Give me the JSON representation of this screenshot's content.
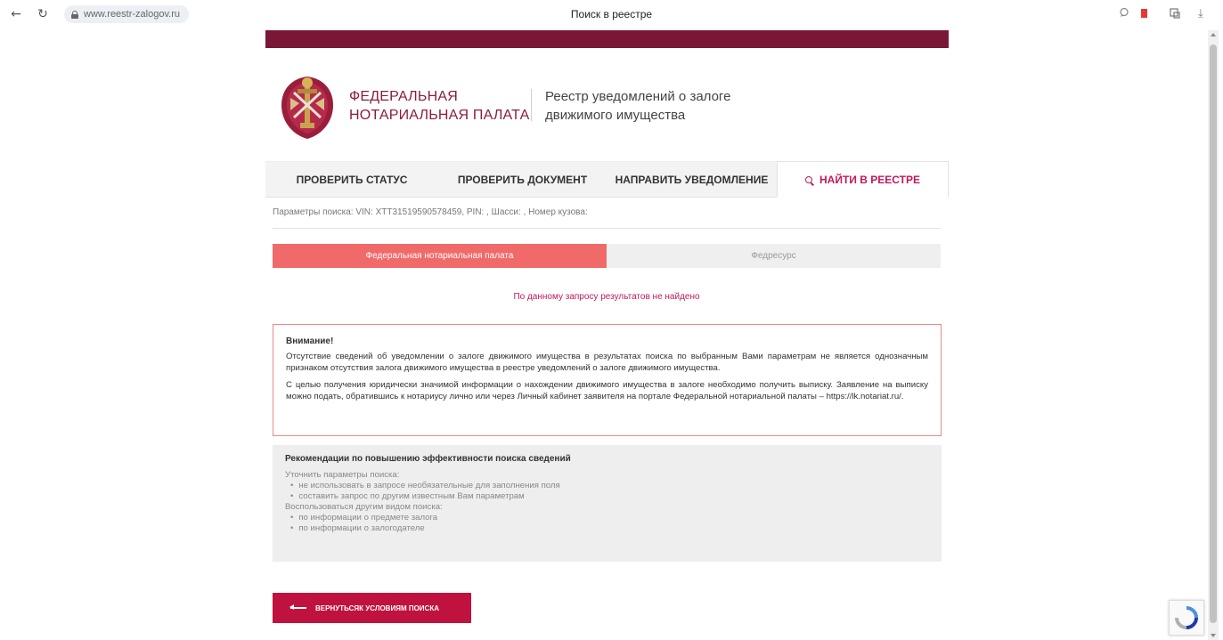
{
  "browser": {
    "back": "←",
    "reload": "↻",
    "url": "www.reestr-zalogov.ru",
    "tab_title": "Поиск в реестре",
    "download": "⤓"
  },
  "header": {
    "brand_line1": "ФЕДЕРАЛЬНАЯ",
    "brand_line2": "НОТАРИАЛЬНАЯ ПАЛАТА",
    "subtitle_line1": "Реестр уведомлений о залоге",
    "subtitle_line2": "движимого имущества"
  },
  "nav": {
    "tabs": [
      {
        "label": "ПРОВЕРИТЬ СТАТУС"
      },
      {
        "label": "ПРОВЕРИТЬ ДОКУМЕНТ"
      },
      {
        "label": "НАПРАВИТЬ УВЕДОМЛЕНИЕ"
      },
      {
        "label": "НАЙТИ В РЕЕСТРЕ"
      }
    ]
  },
  "search": {
    "params": "Параметры поиска: VIN: XTT31519590578459, PIN: , Шасси: , Номер кузова:"
  },
  "sources": {
    "tab_fnp": "Федеральная нотариальная палата",
    "tab_fedresurs": "Федресурс"
  },
  "result": {
    "no_results": "По данному запросу результатов не найдено"
  },
  "warning": {
    "title": "Внимание!",
    "p1": "Отсутствие сведений об уведомлении о залоге движимого имущества в результатах поиска по выбранным Вами параметрам не является однозначным признаком отсутствия залога движимого имущества в реестре уведомлений о залоге движимого имущества.",
    "p2": "С целью получения юридически значимой информации о нахождении движимого имущества в залоге необходимо получить выписку. Заявление на выписку можно подать, обратившись к нотариусу лично или через Личный кабинет заявителя на портале Федеральной нотариальной палаты – https://lk.notariat.ru/."
  },
  "recommendations": {
    "title": "Рекомендации по повышению эффективности поиска сведений",
    "line1": "Уточнить параметры поиска:",
    "b1": "не использовать в запросе необязательные для заполнения поля",
    "b2": "составить запрос по другим известным Вам параметрам",
    "line2": "Воспользоваться другим видом поиска:",
    "b3": "по информации о предмете залога",
    "b4": "по информации о залогодателе"
  },
  "actions": {
    "back_label": "ВЕРНУТЬСЯК УСЛОВИЯМ ПОИСКА"
  },
  "colors": {
    "brand": "#7b1736",
    "accent": "#c2185b",
    "active_source": "#f16a6a",
    "button": "#c0123e"
  }
}
